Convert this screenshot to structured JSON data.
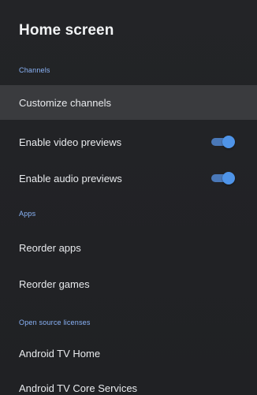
{
  "title": "Home screen",
  "colors": {
    "background": "#202124",
    "focused_row": "#3a3b3e",
    "section_header": "#8ab4f8",
    "toggle_on": "#4f94e8"
  },
  "sections": {
    "channels": {
      "header": "Channels",
      "customize": "Customize channels",
      "video_previews": {
        "label": "Enable video previews",
        "enabled": true
      },
      "audio_previews": {
        "label": "Enable audio previews",
        "enabled": true
      }
    },
    "apps": {
      "header": "Apps",
      "reorder_apps": "Reorder apps",
      "reorder_games": "Reorder games"
    },
    "licenses": {
      "header": "Open source licenses",
      "items": [
        "Android TV Home",
        "Android TV Core Services"
      ]
    }
  }
}
